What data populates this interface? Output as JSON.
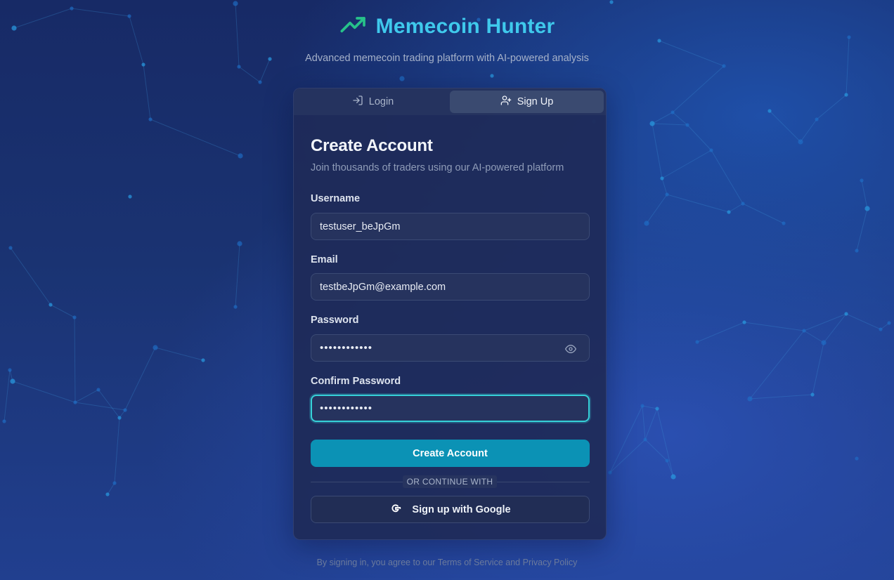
{
  "header": {
    "brand_name": "Memecoin Hunter",
    "subtitle": "Advanced memecoin trading platform with AI-powered analysis",
    "logo_icon": "trending-up-icon",
    "accent_color": "#3fc9ec",
    "logo_color": "#27c28a"
  },
  "tabs": [
    {
      "label": "Login",
      "icon": "login-icon",
      "active": false
    },
    {
      "label": "Sign Up",
      "icon": "user-plus-icon",
      "active": true
    }
  ],
  "form": {
    "title": "Create Account",
    "description": "Join thousands of traders using our AI-powered platform",
    "fields": {
      "username": {
        "label": "Username",
        "value": "testuser_beJpGm"
      },
      "email": {
        "label": "Email",
        "value": "testbeJpGm@example.com"
      },
      "password": {
        "label": "Password",
        "value": "••••••••••••",
        "toggle_icon": "eye-icon"
      },
      "confirm_password": {
        "label": "Confirm Password",
        "value": "••••••••••••"
      }
    },
    "submit_label": "Create Account",
    "divider_text": "OR CONTINUE WITH",
    "google_label": "Sign up with Google",
    "google_icon": "google-icon"
  },
  "footer": {
    "prefix": "By signing in, you agree to our",
    "terms": "Terms of Service",
    "and": "and",
    "privacy": "Privacy Policy"
  },
  "colors": {
    "primary_button": "#0b92b5",
    "focus_ring": "#36d1d8"
  }
}
